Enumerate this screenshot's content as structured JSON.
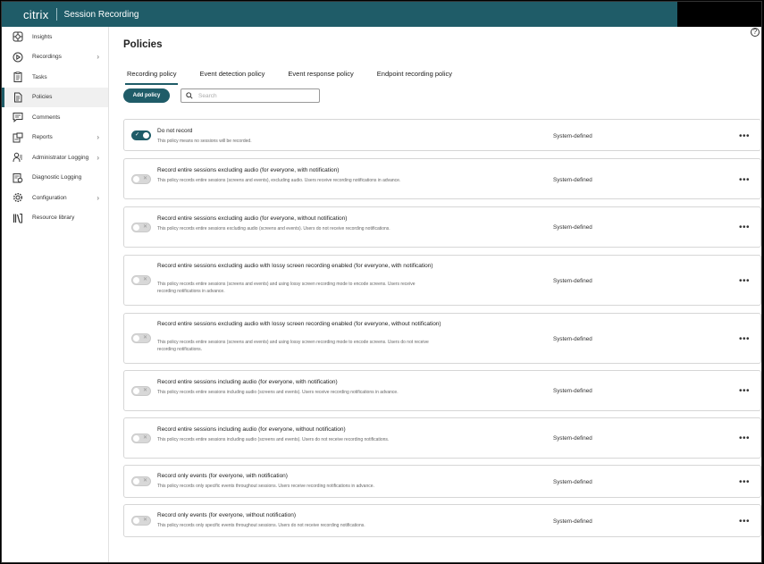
{
  "header": {
    "brand": "citrix",
    "product": "Session Recording"
  },
  "help_icon": "?",
  "sidebar": {
    "items": [
      {
        "label": "Insights",
        "icon": "insights-icon",
        "chevron": false
      },
      {
        "label": "Recordings",
        "icon": "recordings-icon",
        "chevron": true
      },
      {
        "label": "Tasks",
        "icon": "tasks-icon",
        "chevron": false
      },
      {
        "label": "Policies",
        "icon": "policies-icon",
        "chevron": false,
        "active": true
      },
      {
        "label": "Comments",
        "icon": "comments-icon",
        "chevron": false
      },
      {
        "label": "Reports",
        "icon": "reports-icon",
        "chevron": true
      },
      {
        "label": "Administrator Logging",
        "icon": "admin-logging-icon",
        "chevron": true
      },
      {
        "label": "Diagnostic Logging",
        "icon": "diagnostic-logging-icon",
        "chevron": false
      },
      {
        "label": "Configuration",
        "icon": "configuration-icon",
        "chevron": true
      },
      {
        "label": "Resource library",
        "icon": "resource-library-icon",
        "chevron": false
      }
    ]
  },
  "page": {
    "title": "Policies"
  },
  "tabs": [
    {
      "label": "Recording policy",
      "active": true
    },
    {
      "label": "Event detection policy"
    },
    {
      "label": "Event response policy"
    },
    {
      "label": "Endpoint recording policy"
    }
  ],
  "toolbar": {
    "add_label": "Add policy",
    "search_placeholder": "Search"
  },
  "policies": [
    {
      "name": "Do not record",
      "description": "This policy means no sessions will be recorded.",
      "type": "System-defined",
      "enabled": true,
      "more": "•••"
    },
    {
      "name": "Record entire sessions excluding audio (for everyone, with notification)",
      "description": "This policy records entire sessions (screens and events), excluding audio. Users receive recording notifications in advance.",
      "type": "System-defined",
      "enabled": false,
      "more": "•••"
    },
    {
      "name": "Record entire sessions excluding audio (for everyone, without notification)",
      "description": "This policy records entire sessions excluding audio (screens and events). Users do not receive recording notifications.",
      "type": "System-defined",
      "enabled": false,
      "more": "•••"
    },
    {
      "name": "Record entire sessions excluding audio with lossy screen recording enabled (for everyone, with notification)",
      "description": "This policy records entire sessions (screens and events) and using lossy screen recording mode to encode screens. Users receive recording notifications in advance.",
      "type": "System-defined",
      "enabled": false,
      "more": "•••"
    },
    {
      "name": "Record entire sessions excluding audio with lossy screen recording enabled (for everyone, without notification)",
      "description": "This policy records entire sessions (screens and events) and using lossy screen recording mode to encode screens. Users do not receive recording notifications.",
      "type": "System-defined",
      "enabled": false,
      "more": "•••"
    },
    {
      "name": "Record entire sessions including audio (for everyone, with notification)",
      "description": "This policy records entire sessions including audio (screens and events). Users receive recording notifications in advance.",
      "type": "System-defined",
      "enabled": false,
      "more": "•••"
    },
    {
      "name": "Record entire sessions including audio (for everyone, without notification)",
      "description": "This policy records entire sessions including audio (screens and events). Users do not receive recording notifications.",
      "type": "System-defined",
      "enabled": false,
      "more": "•••"
    },
    {
      "name": "Record only events (for everyone, with notification)",
      "description": "This policy records only specific events throughout sessions. Users receive recording notifications in advance.",
      "type": "System-defined",
      "enabled": false,
      "more": "•••"
    },
    {
      "name": "Record only events (for everyone, without notification)",
      "description": "This policy records only specific events throughout sessions. Users do not receive recording notifications.",
      "type": "System-defined",
      "enabled": false,
      "more": "•••"
    }
  ],
  "colors": {
    "brand_teal": "#1f5c68"
  }
}
